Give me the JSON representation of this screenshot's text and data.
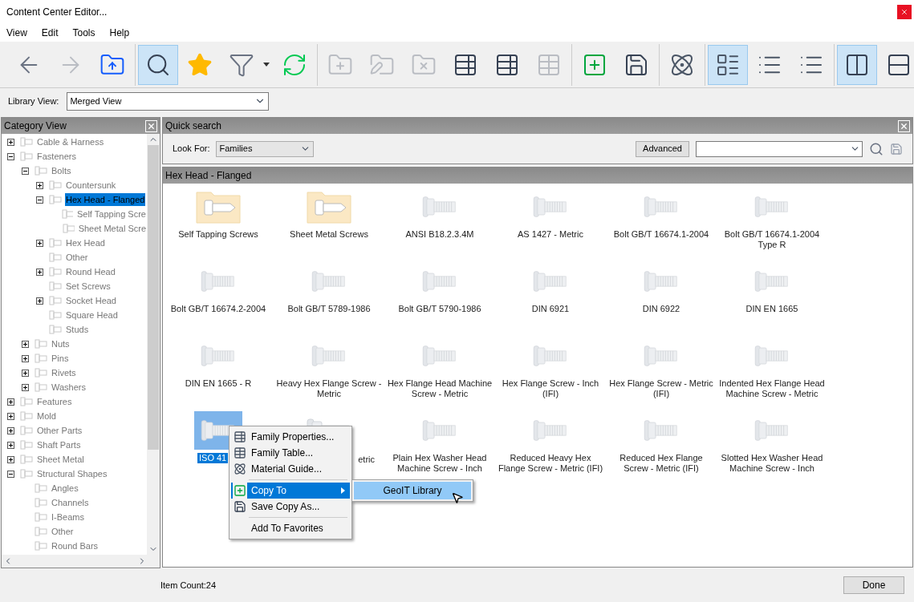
{
  "window": {
    "title": "Content Center Editor..."
  },
  "menu": [
    "View",
    "Edit",
    "Tools",
    "Help"
  ],
  "toolbar": {
    "groups": [
      [
        {
          "kind": "back",
          "selected": false,
          "disabled": false
        },
        {
          "kind": "forward",
          "selected": false,
          "disabled": true
        },
        {
          "kind": "folder-up",
          "selected": false,
          "disabled": false
        }
      ],
      [
        {
          "kind": "search",
          "selected": true,
          "disabled": false
        },
        {
          "kind": "favorites",
          "selected": false,
          "disabled": false
        },
        {
          "kind": "filter",
          "selected": false,
          "disabled": false
        },
        {
          "kind": "refresh",
          "selected": false,
          "disabled": false
        }
      ],
      [
        {
          "kind": "folder-add",
          "selected": false,
          "disabled": true
        },
        {
          "kind": "folder-edit",
          "selected": false,
          "disabled": true
        },
        {
          "kind": "folder-delete",
          "selected": false,
          "disabled": true
        },
        {
          "kind": "table-edit",
          "selected": false,
          "disabled": false
        },
        {
          "kind": "table-edit",
          "selected": false,
          "disabled": false
        },
        {
          "kind": "table-delete",
          "selected": false,
          "disabled": true
        }
      ],
      [
        {
          "kind": "copy-to",
          "selected": false,
          "disabled": false
        },
        {
          "kind": "save-as",
          "selected": false,
          "disabled": false
        }
      ],
      [
        {
          "kind": "material",
          "selected": false,
          "disabled": false
        }
      ],
      [
        {
          "kind": "large-icons",
          "selected": true,
          "disabled": false
        },
        {
          "kind": "small-icons",
          "selected": false,
          "disabled": false
        },
        {
          "kind": "details",
          "selected": false,
          "disabled": false
        }
      ],
      [
        {
          "kind": "split-vertical",
          "selected": true,
          "disabled": false
        },
        {
          "kind": "split-horizontal",
          "selected": false,
          "disabled": false
        }
      ]
    ]
  },
  "library_view": {
    "label": "Library View:",
    "value": "Merged View"
  },
  "category_view": {
    "title": "Category View",
    "tree": [
      {
        "label": "Cable & Harness",
        "expanded": false
      },
      {
        "label": "Fasteners",
        "expanded": true,
        "children": [
          {
            "label": "Bolts",
            "expanded": true,
            "children": [
              {
                "label": "Countersunk",
                "expanded": false
              },
              {
                "label": "Hex Head - Flanged",
                "expanded": true,
                "selected": true,
                "children": [
                  {
                    "label": "Self Tapping Scre"
                  },
                  {
                    "label": "Sheet Metal Scre"
                  }
                ]
              },
              {
                "label": "Hex Head",
                "expanded": false
              },
              {
                "label": "Other"
              },
              {
                "label": "Round Head",
                "expanded": false
              },
              {
                "label": "Set Screws"
              },
              {
                "label": "Socket Head",
                "expanded": false
              },
              {
                "label": "Square Head"
              },
              {
                "label": "Studs"
              }
            ]
          },
          {
            "label": "Nuts",
            "expanded": false
          },
          {
            "label": "Pins",
            "expanded": false
          },
          {
            "label": "Rivets",
            "expanded": false
          },
          {
            "label": "Washers",
            "expanded": false
          }
        ]
      },
      {
        "label": "Features",
        "expanded": false
      },
      {
        "label": "Mold",
        "expanded": false
      },
      {
        "label": "Other Parts",
        "expanded": false
      },
      {
        "label": "Shaft Parts",
        "expanded": false
      },
      {
        "label": "Sheet Metal",
        "expanded": false
      },
      {
        "label": "Structural Shapes",
        "expanded": true,
        "children": [
          {
            "label": "Angles"
          },
          {
            "label": "Channels"
          },
          {
            "label": "I-Beams"
          },
          {
            "label": "Other"
          },
          {
            "label": "Round Bars"
          }
        ]
      }
    ]
  },
  "quick_search": {
    "title": "Quick search",
    "look_for_label": "Look For:",
    "look_for_value": "Families",
    "advanced_button": "Advanced"
  },
  "content": {
    "title": "Hex Head - Flanged",
    "items": [
      {
        "kind": "folder",
        "label": "Self Tapping Screws",
        "selected": false
      },
      {
        "kind": "folder",
        "label": "Sheet Metal Screws",
        "selected": false
      },
      {
        "kind": "part",
        "label": "ANSI B18.2.3.4M",
        "selected": false
      },
      {
        "kind": "part",
        "label": "AS 1427 - Metric",
        "selected": false
      },
      {
        "kind": "part",
        "label": "Bolt GB/T 16674.1-2004",
        "selected": false
      },
      {
        "kind": "part",
        "label": "Bolt GB/T 16674.1-2004 Type R",
        "selected": false
      },
      {
        "kind": "part",
        "label": "Bolt GB/T 16674.2-2004",
        "selected": false
      },
      {
        "kind": "part",
        "label": "Bolt GB/T 5789-1986",
        "selected": false
      },
      {
        "kind": "part",
        "label": "Bolt GB/T 5790-1986",
        "selected": false
      },
      {
        "kind": "part",
        "label": "DIN 6921",
        "selected": false
      },
      {
        "kind": "part",
        "label": "DIN 6922",
        "selected": false
      },
      {
        "kind": "part",
        "label": "DIN EN 1665",
        "selected": false
      },
      {
        "kind": "part",
        "label": "DIN EN 1665 - R",
        "selected": false
      },
      {
        "kind": "part",
        "label": "Heavy Hex Flange Screw - Metric",
        "selected": false
      },
      {
        "kind": "part",
        "label": "Hex Flange Head Machine Screw - Metric",
        "selected": false
      },
      {
        "kind": "part",
        "label": "Hex Flange Screw - Inch (IFI)",
        "selected": false
      },
      {
        "kind": "part",
        "label": "Hex Flange Screw - Metric (IFI)",
        "selected": false
      },
      {
        "kind": "part",
        "label": "Indented Hex Flange Head Machine Screw - Metric",
        "selected": false
      },
      {
        "kind": "part",
        "label": "ISO 41",
        "selected": true
      },
      {
        "kind": "covered",
        "label": "etric",
        "selected": false
      },
      {
        "kind": "part",
        "label": "Plain Hex Washer Head Machine Screw - Inch",
        "selected": false
      },
      {
        "kind": "part",
        "label": "Reduced Heavy Hex Flange Screw - Metric (IFI)",
        "selected": false
      },
      {
        "kind": "part",
        "label": "Reduced Hex Flange Screw - Metric (IFI)",
        "selected": false
      },
      {
        "kind": "part",
        "label": "Slotted Hex Washer Head Machine Screw - Inch",
        "selected": false
      }
    ]
  },
  "context_menu": {
    "items": [
      {
        "kind": "item",
        "label": "Family Properties...",
        "selected": false
      },
      {
        "kind": "item",
        "label": "Family Table...",
        "selected": false
      },
      {
        "kind": "item",
        "label": "Material Guide...",
        "selected": false
      },
      {
        "kind": "separator"
      },
      {
        "kind": "submenu",
        "label": "Copy To",
        "selected": true
      },
      {
        "kind": "item",
        "label": "Save Copy As...",
        "selected": false
      },
      {
        "kind": "separator"
      },
      {
        "kind": "item",
        "label": "Add To Favorites",
        "selected": false
      }
    ],
    "submenu": [
      {
        "label": "GeoIT Library",
        "selected": true
      }
    ]
  },
  "status_bar": {
    "item_count": "Item Count:24",
    "done_button": "Done"
  }
}
